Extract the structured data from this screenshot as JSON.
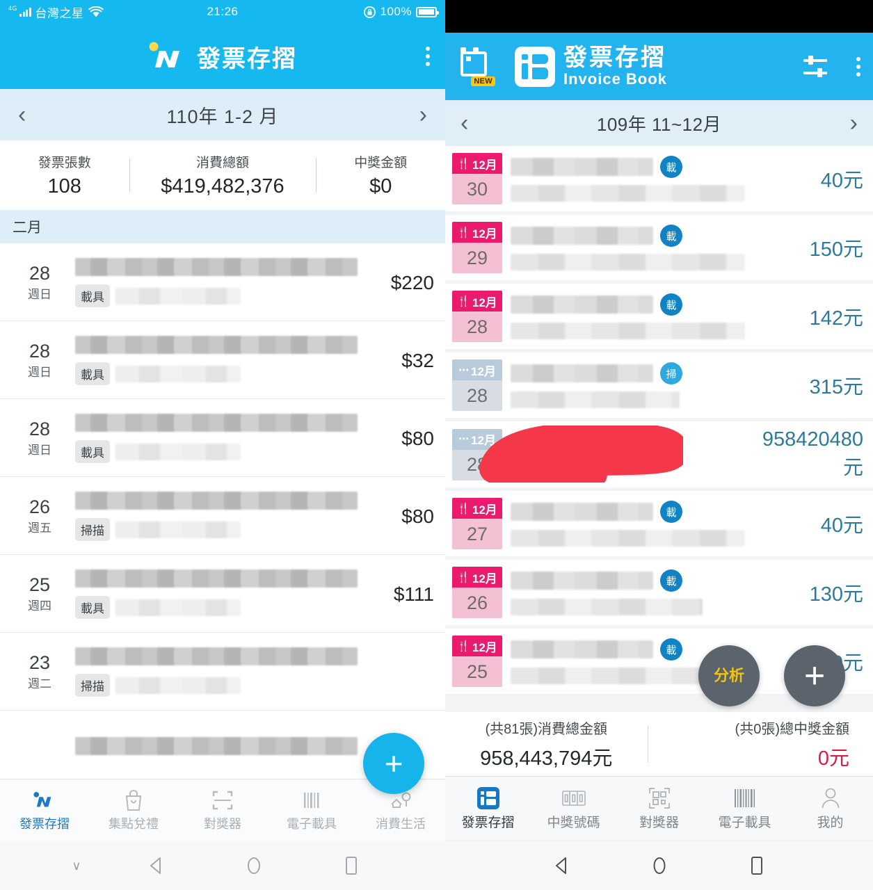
{
  "left": {
    "status_bar": {
      "network": "4G",
      "carrier": "台灣之星",
      "wifi_icon": "wifi-icon",
      "time": "21:26",
      "rotation_lock_icon": "rotation-lock-icon",
      "battery_percent": "100%"
    },
    "app_bar": {
      "logo_icon": "invoice-book-logo",
      "title": "發票存摺",
      "menu_icon": "kebab-menu-icon"
    },
    "month_bar": {
      "prev_icon": "chevron-left-icon",
      "label": "110年 1-2 月",
      "next_icon": "chevron-right-icon"
    },
    "summary": [
      {
        "label": "發票張數",
        "value": "108"
      },
      {
        "label": "消費總額",
        "value": "$419,482,376"
      },
      {
        "label": "中獎金額",
        "value": "$0"
      }
    ],
    "month_header": "二月",
    "rows": [
      {
        "day": "28",
        "weekday": "週日",
        "tag": "載具",
        "amount": "$220"
      },
      {
        "day": "28",
        "weekday": "週日",
        "tag": "載具",
        "amount": "$32"
      },
      {
        "day": "28",
        "weekday": "週日",
        "tag": "載具",
        "amount": "$80"
      },
      {
        "day": "26",
        "weekday": "週五",
        "tag": "掃描",
        "amount": "$80"
      },
      {
        "day": "25",
        "weekday": "週四",
        "tag": "載具",
        "amount": "$111"
      },
      {
        "day": "23",
        "weekday": "週二",
        "tag": "掃描",
        "amount": ""
      }
    ],
    "fab": {
      "icon": "plus-icon",
      "label": "+"
    },
    "tabs": [
      {
        "label": "發票存摺",
        "icon": "invoice-book-icon",
        "active": true
      },
      {
        "label": "集點兌禮",
        "icon": "gift-bag-icon",
        "active": false
      },
      {
        "label": "對獎器",
        "icon": "scan-frame-icon",
        "active": false
      },
      {
        "label": "電子載具",
        "icon": "barcode-icon",
        "active": false
      },
      {
        "label": "消費生活",
        "icon": "map-pin-icon",
        "active": false
      }
    ],
    "android_nav": [
      {
        "icon": "hide-keyboard-chevron-icon",
        "glyph": "∨"
      },
      {
        "icon": "back-icon",
        "glyph": "◁"
      },
      {
        "icon": "home-icon",
        "glyph": "◯"
      },
      {
        "icon": "recents-icon",
        "glyph": "▢"
      }
    ]
  },
  "right": {
    "app_bar": {
      "calendar_icon": "calendar-new-icon",
      "new_badge": "NEW",
      "logo_icon": "invoice-book-mark-icon",
      "title_cn": "發票存摺",
      "title_en": "Invoice Book",
      "filter_icon": "filter-sliders-icon",
      "menu_icon": "kebab-menu-icon"
    },
    "month_bar": {
      "prev_icon": "chevron-left-icon",
      "label": "109年 11~12月",
      "next_icon": "chevron-right-icon"
    },
    "rows": [
      {
        "month": "12月",
        "day": "30",
        "type": "food",
        "type_icon": "cutlery-icon",
        "chip": "載",
        "chip_kind": "carrier",
        "amount": "40元",
        "redacted": false
      },
      {
        "month": "12月",
        "day": "29",
        "type": "food",
        "type_icon": "cutlery-icon",
        "chip": "載",
        "chip_kind": "carrier",
        "amount": "150元",
        "redacted": false
      },
      {
        "month": "12月",
        "day": "28",
        "type": "food",
        "type_icon": "cutlery-icon",
        "chip": "載",
        "chip_kind": "carrier",
        "amount": "142元",
        "redacted": false
      },
      {
        "month": "12月",
        "day": "28",
        "type": "other",
        "type_icon": "dots-icon",
        "chip": "掃",
        "chip_kind": "scan",
        "amount": "315元",
        "redacted": false
      },
      {
        "month": "12月",
        "day": "28",
        "type": "other",
        "type_icon": "dots-icon",
        "chip": "",
        "chip_kind": "",
        "amount": "958420480元",
        "redacted": true
      },
      {
        "month": "12月",
        "day": "27",
        "type": "food",
        "type_icon": "cutlery-icon",
        "chip": "載",
        "chip_kind": "carrier",
        "amount": "40元",
        "redacted": false
      },
      {
        "month": "12月",
        "day": "26",
        "type": "food",
        "type_icon": "cutlery-icon",
        "chip": "載",
        "chip_kind": "carrier",
        "amount": "130元",
        "redacted": false
      },
      {
        "month": "12月",
        "day": "25",
        "type": "food",
        "type_icon": "cutlery-icon",
        "chip": "載",
        "chip_kind": "carrier",
        "amount": "130元",
        "redacted": false
      }
    ],
    "fabs": {
      "analysis_label": "分析",
      "analysis_icon": "analysis-fab-icon",
      "plus_label": "+",
      "plus_icon": "add-fab-icon"
    },
    "footer": [
      {
        "label": "(共81張)消費總金額",
        "value": "958,443,794元"
      },
      {
        "label": "(共0張)總中獎金額",
        "value": "0元"
      }
    ],
    "tabs": [
      {
        "label": "發票存摺",
        "icon": "invoice-book-icon",
        "active": true
      },
      {
        "label": "中獎號碼",
        "icon": "prize-numbers-icon",
        "active": false
      },
      {
        "label": "對獎器",
        "icon": "qr-scan-icon",
        "active": false
      },
      {
        "label": "電子載具",
        "icon": "barcode-icon",
        "active": false
      },
      {
        "label": "我的",
        "icon": "user-icon",
        "active": false
      }
    ],
    "android_nav": [
      {
        "icon": "back-icon",
        "glyph": "◁"
      },
      {
        "icon": "home-icon",
        "glyph": "◯"
      },
      {
        "icon": "recents-icon",
        "glyph": "▢"
      }
    ]
  },
  "colors": {
    "left_accent": "#15b9f0",
    "right_accent": "#23b3ef",
    "food_badge": "#ec1a6e",
    "amount_teal": "#2e7a9c",
    "prize_red": "#d81b4a",
    "scribble_red": "#f4384a",
    "fab_gray": "#5b646c",
    "analysis_yellow": "#f3c40d"
  }
}
